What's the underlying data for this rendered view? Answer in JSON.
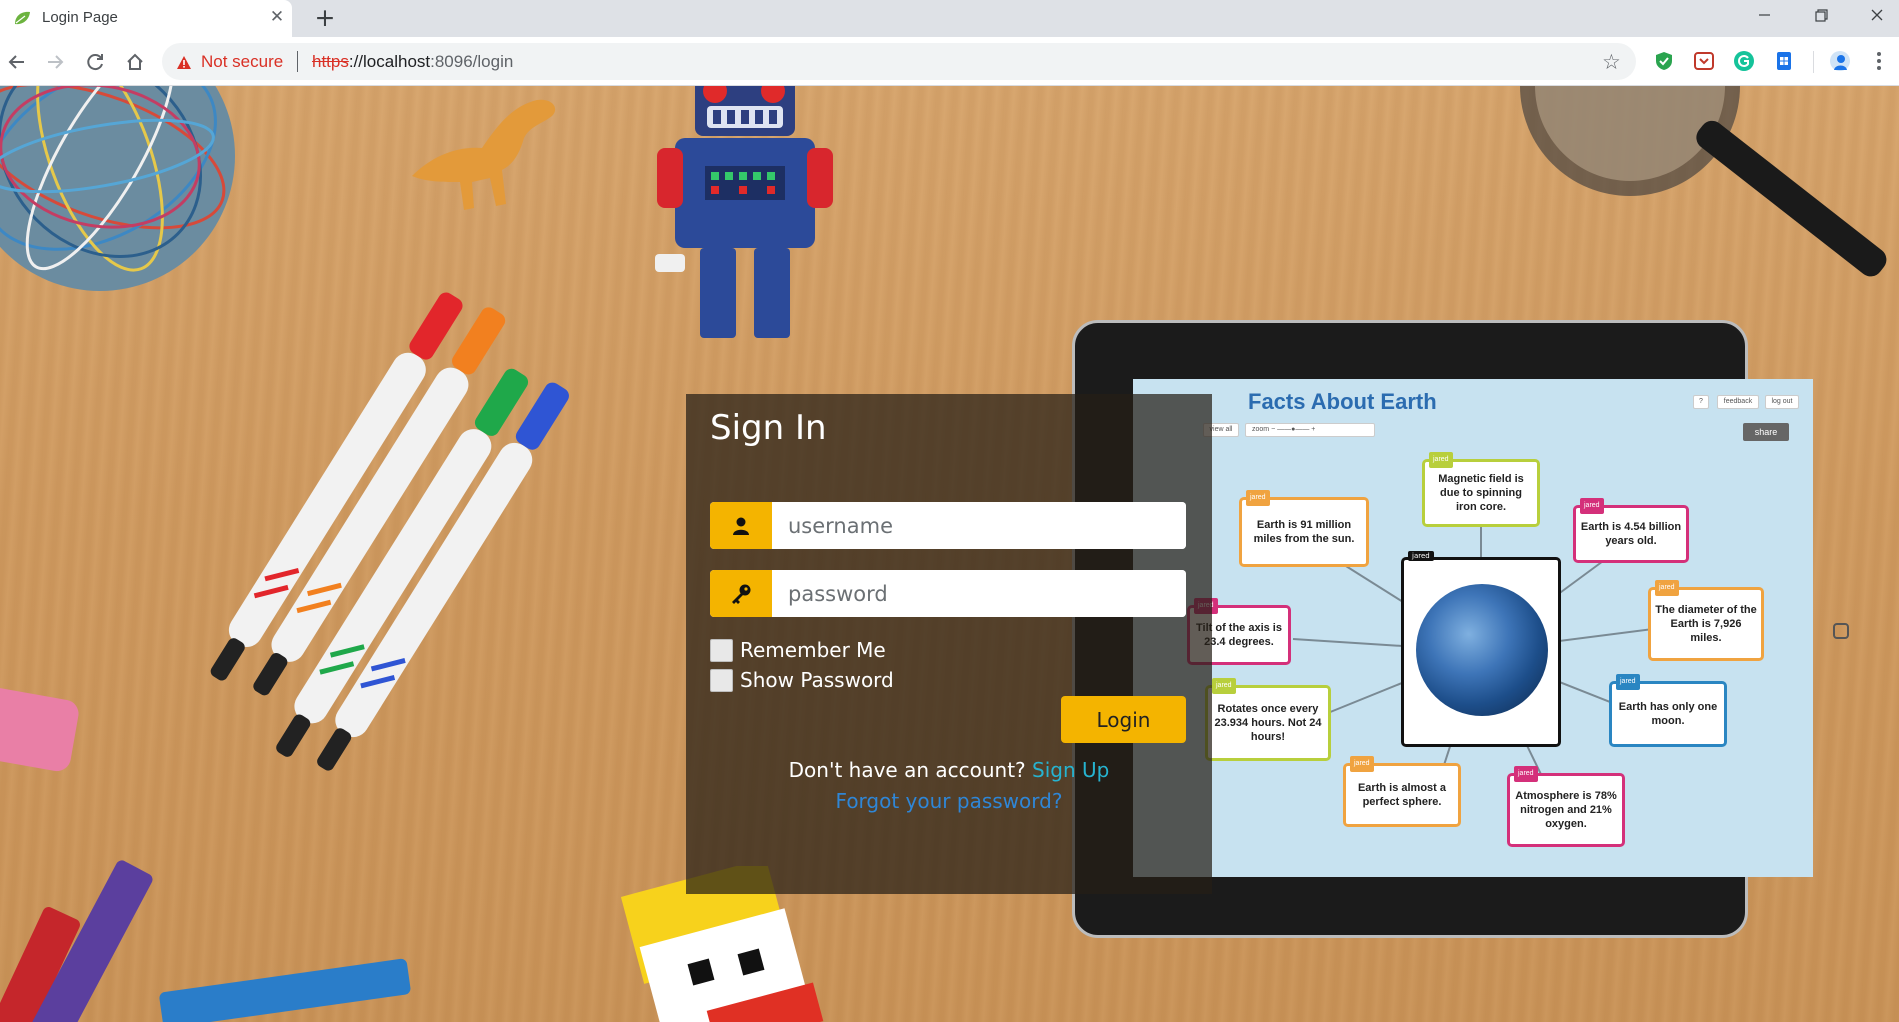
{
  "browser": {
    "tab_title": "Login Page",
    "tab_close_glyph": "✕",
    "new_tab_glyph": "+",
    "security_label": "Not secure",
    "url_scheme": "https",
    "url_host": "://localhost",
    "url_rest": ":8096/login",
    "bookmark_glyph": "☆"
  },
  "signin": {
    "title": "Sign In",
    "username_placeholder": "username",
    "password_placeholder": "password",
    "remember_label": "Remember Me",
    "show_password_label": "Show Password",
    "login_label": "Login",
    "signup_prompt": "Don't have an account?",
    "signup_link": "Sign Up",
    "forgot_link": "Forgot your password?"
  },
  "tablet": {
    "title": "Facts About Earth",
    "mini_viewall": "view all",
    "mini_zoom": "zoom",
    "mini_help": "?",
    "mini_feedback": "feedback",
    "mini_logout": "log out",
    "share": "share",
    "tag": "jared",
    "notes": {
      "magnetic": "Magnetic field is due to spinning iron core.",
      "distance": "Earth is 91 million miles from the sun.",
      "age": "Earth is 4.54 billion years old.",
      "tilt": "Tilt of the axis is 23.4 degrees.",
      "diameter": "The diameter of the Earth is 7,926 miles.",
      "rotation": "Rotates once every 23.934 hours. Not 24 hours!",
      "moon": "Earth has only one moon.",
      "sphere": "Earth is almost a perfect sphere.",
      "atmosphere": "Atmosphere is 78% nitrogen and 21% oxygen."
    }
  },
  "colors": {
    "accent": "#f4b400",
    "signup_link": "#26b3d0",
    "forgot_link": "#2f86d6",
    "not_secure": "#d93025"
  }
}
